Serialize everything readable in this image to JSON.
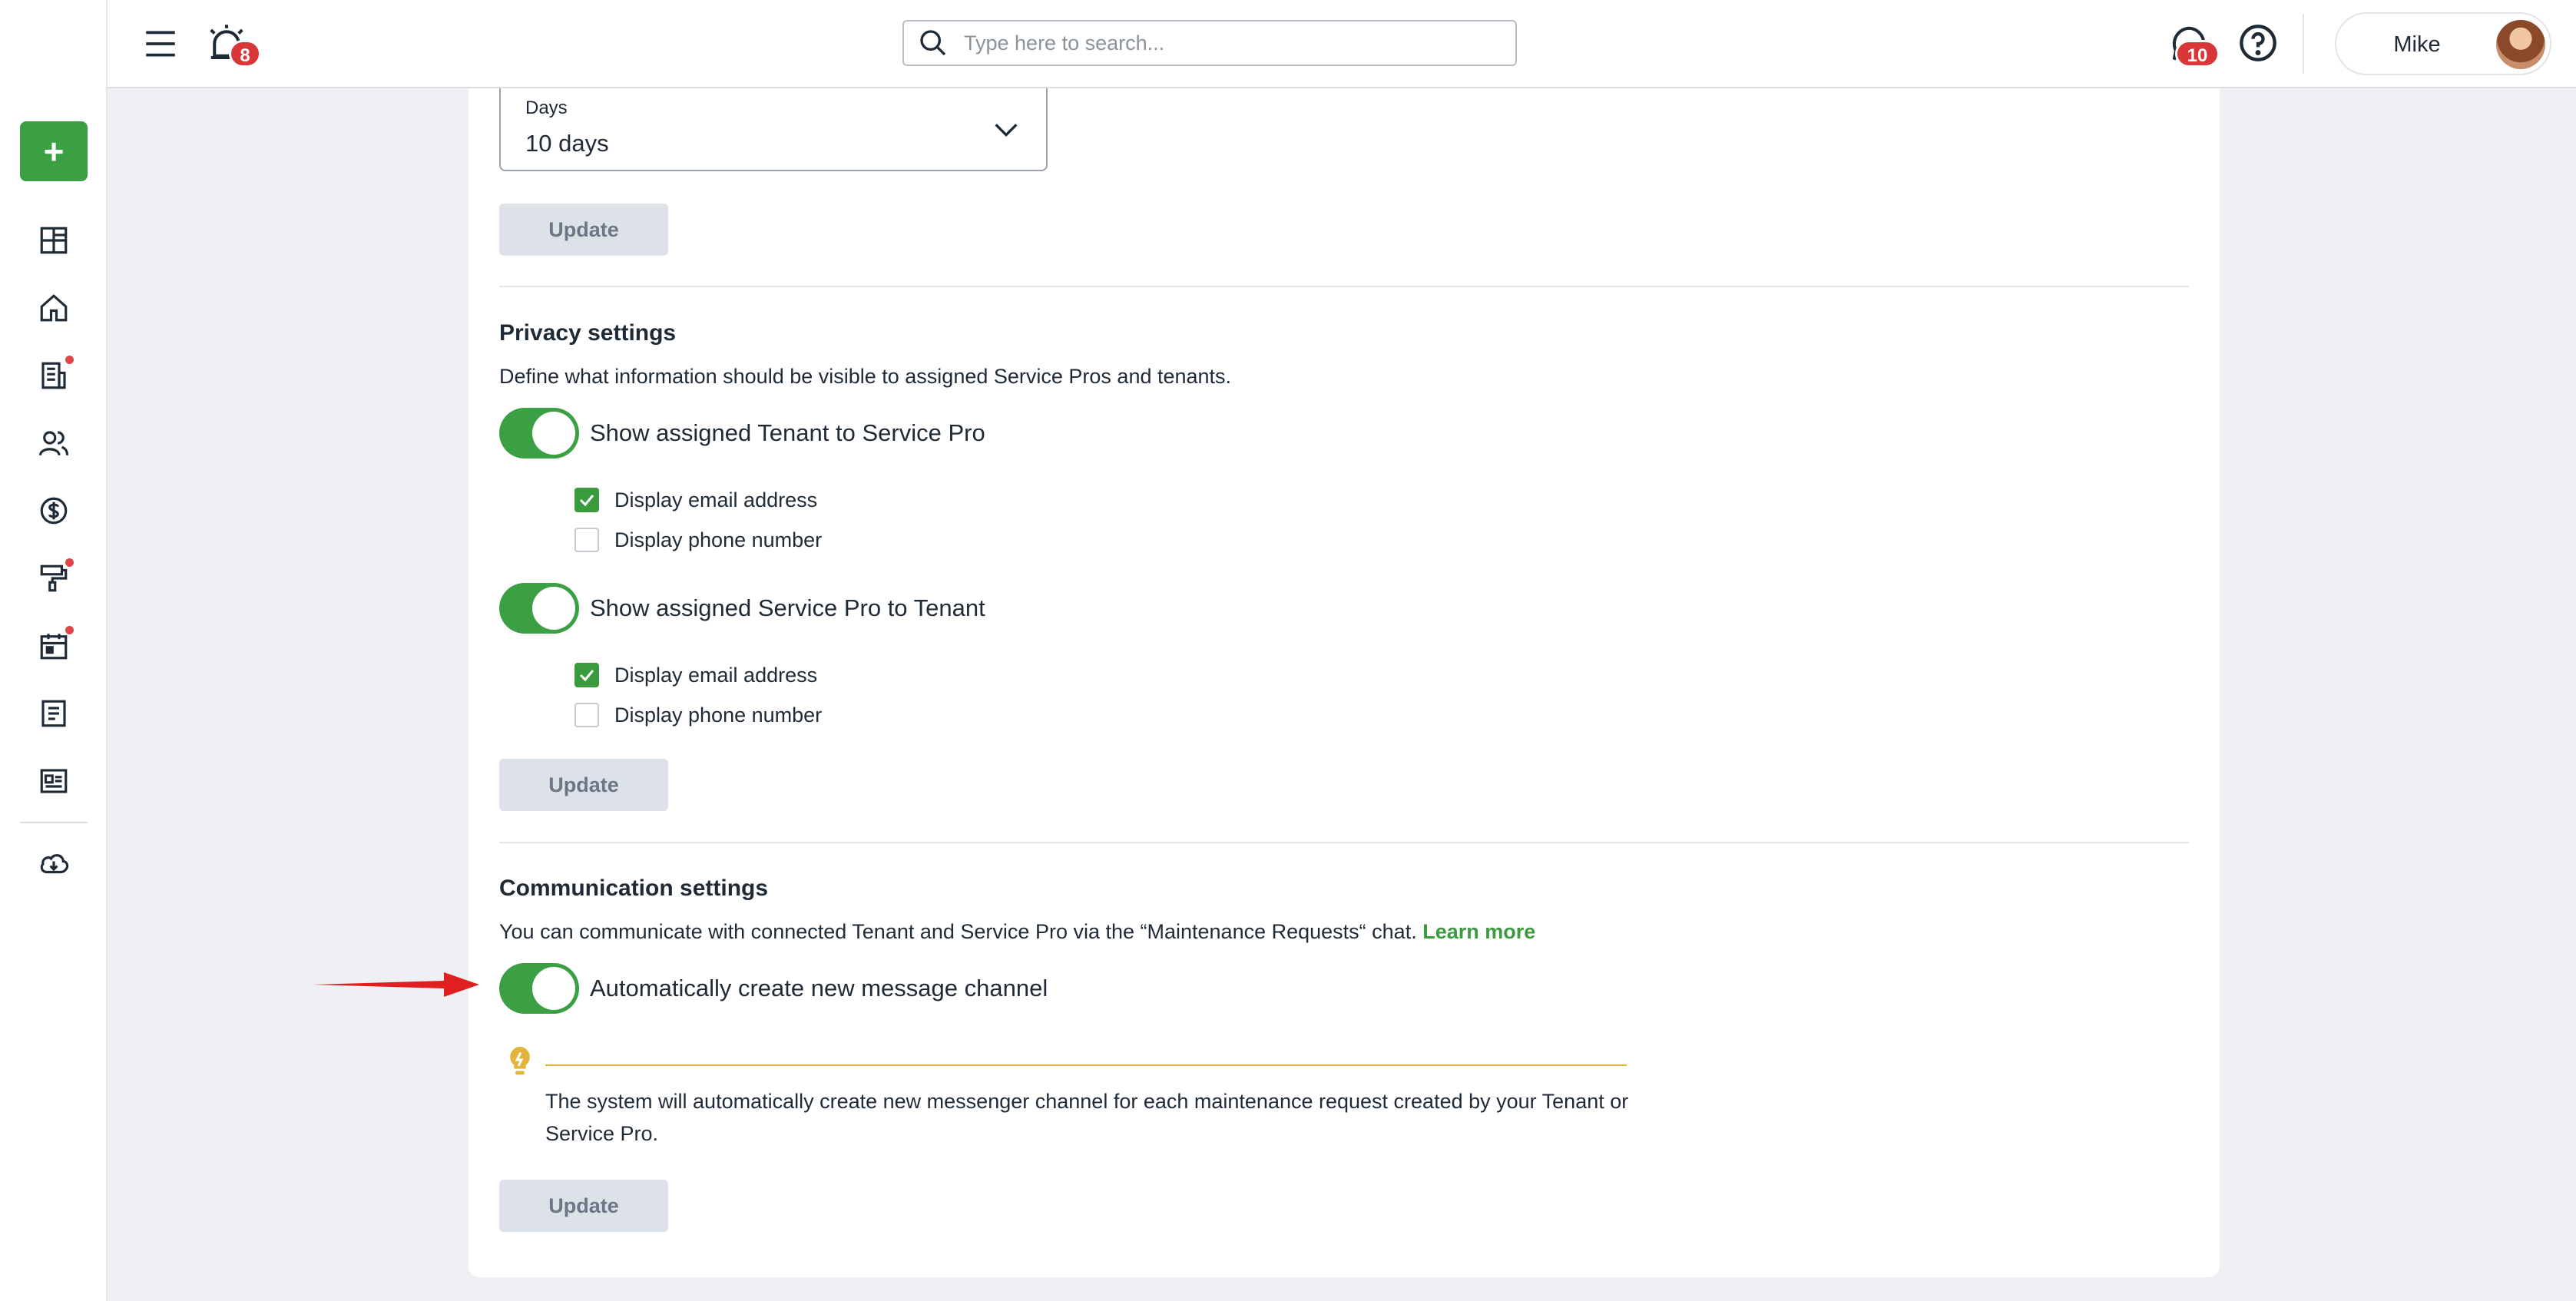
{
  "topbar": {
    "notifications_badge": "8",
    "search_placeholder": "Type here to search...",
    "messages_badge": "10",
    "user_name": "Mike"
  },
  "days_select": {
    "label": "Days",
    "value": "10 days"
  },
  "buttons": {
    "update_label": "Update"
  },
  "privacy": {
    "title": "Privacy settings",
    "description": "Define what information should be visible to assigned Service Pros and tenants.",
    "toggle1_label": "Show assigned Tenant to Service Pro",
    "toggle1_email": "Display email address",
    "toggle1_phone": "Display phone number",
    "toggle2_label": "Show assigned Service Pro to Tenant",
    "toggle2_email": "Display email address",
    "toggle2_phone": "Display phone number"
  },
  "communication": {
    "title": "Communication settings",
    "description": "You can communicate with connected Tenant and Service Pro via the “Maintenance Requests“ chat.",
    "learn_more": "Learn more",
    "toggle_label": "Automatically create new message channel",
    "tip_text": "The system will automatically create new messenger channel for each maintenance request created by your Tenant or Service Pro."
  },
  "states": {
    "toggle1_on": true,
    "toggle1_email_checked": true,
    "toggle1_phone_checked": false,
    "toggle2_on": true,
    "toggle2_email_checked": true,
    "toggle2_phone_checked": false,
    "auto_channel_on": true
  },
  "colors": {
    "accent_green": "#3aa043",
    "badge_red": "#d93737",
    "tip_yellow": "#e3b43c",
    "annotation_arrow": "#e02020"
  },
  "icons": {
    "sidebar": [
      "dashboard-icon",
      "home-icon",
      "buildings-icon",
      "people-icon",
      "dollar-icon",
      "paint-roller-icon",
      "calendar-icon",
      "document-icon",
      "id-card-icon",
      "cloud-download-icon"
    ]
  }
}
